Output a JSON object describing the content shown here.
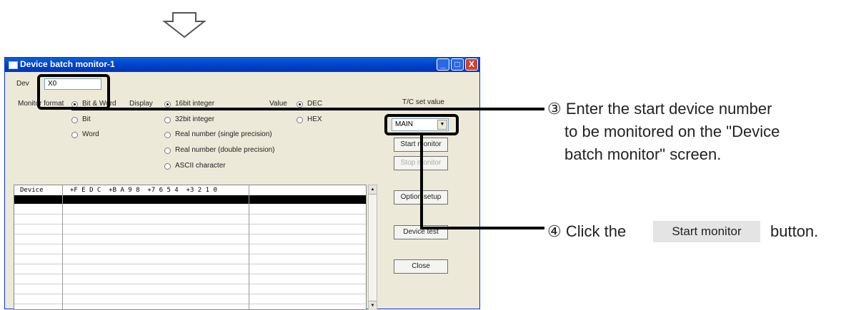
{
  "window": {
    "title": "Device batch monitor-1",
    "controls": {
      "minimize": "_",
      "maximize": "□",
      "close": "X"
    }
  },
  "form": {
    "device_label": "Dev",
    "device_value": "X0",
    "monitor_format_label": "Monitor format",
    "bit_word_label": "Bit & Word",
    "bit_label": "Bit",
    "word_label": "Word",
    "display_label": "Display",
    "display_options": [
      "16bit integer",
      "32bit integer",
      "Real number (single precision)",
      "Real number (double precision)",
      "ASCII character"
    ],
    "value_label": "Value",
    "value_options": [
      "DEC",
      "HEX"
    ],
    "tc_set_value_label": "T/C set value",
    "tc_select_value": "MAIN"
  },
  "buttons": {
    "start_monitor": "Start monitor",
    "stop_monitor": "Stop monitor",
    "option_setup": "Option setup",
    "device_test": "Device test",
    "close": "Close"
  },
  "table": {
    "col_device": "Device",
    "col_bits": "+F E D C  +B A 9 8  +7 6 5 4  +3 2 1 0"
  },
  "annotations": {
    "step3": [
      "③ Enter the start device number",
      "to be monitored on the \"Device",
      "batch monitor\" screen."
    ],
    "step4_prefix": "④ Click the",
    "step4_button": "Start monitor",
    "step4_suffix": "button."
  }
}
